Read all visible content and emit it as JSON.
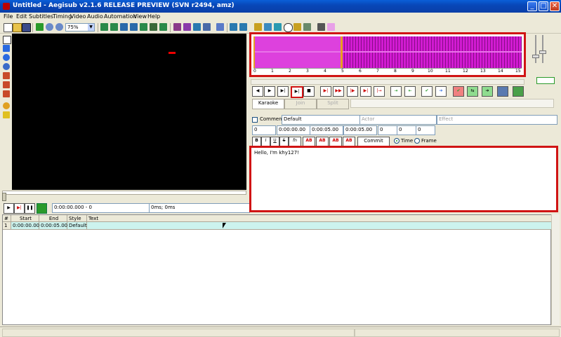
{
  "window": {
    "title": "Untitled - Aegisub v2.1.6 RELEASE PREVIEW (SVN r2494, amz)",
    "min": "_",
    "max": "□",
    "close": "✕"
  },
  "menu": [
    "File",
    "Edit",
    "Subtitles",
    "Timing",
    "Video",
    "Audio",
    "Automation",
    "View",
    "Help"
  ],
  "toolbar": {
    "zoom": "75%"
  },
  "video": {
    "time": "0:00:00.000 - 0",
    "offset": "0ms; 0ms",
    "buttons": {
      "play": "▶",
      "play_line": "▶|",
      "pause": "❚❚"
    }
  },
  "audio": {
    "timeline": [
      "0",
      "1",
      "2",
      "3",
      "4",
      "5",
      "6",
      "7",
      "8",
      "9",
      "10",
      "11",
      "12",
      "13",
      "14",
      "15"
    ],
    "karaoke": "Karaoke",
    "join": "Join",
    "split": "Split"
  },
  "edit": {
    "comment_label": "Comment",
    "style": "Default",
    "actor_placeholder": "Actor",
    "effect_placeholder": "Effect",
    "layer": "0",
    "start": "0:00:00.00",
    "end": "0:00:05.00",
    "duration": "0:00:05.00",
    "margin_l": "0",
    "margin_r": "0",
    "margin_v": "0",
    "bold": "B",
    "italic": "I",
    "underline": "U",
    "strike": "S",
    "font": "fn",
    "color1": "AB",
    "color2": "AB",
    "color3": "AB",
    "color4": "AB",
    "commit": "Commit",
    "time_label": "Time",
    "frame_label": "Frame",
    "text": "Hello, I'm khy127!"
  },
  "grid": {
    "headers": [
      "#",
      "Start",
      "End",
      "Style",
      "Text"
    ],
    "rows": [
      {
        "num": "1",
        "start": "0:00:00.00",
        "end": "0:00:05.00",
        "style": "Default",
        "text": ""
      }
    ]
  }
}
